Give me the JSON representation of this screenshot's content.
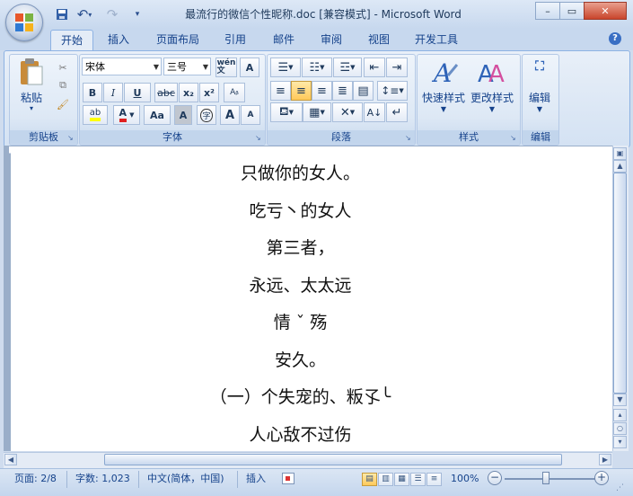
{
  "window": {
    "title": "最流行的微信个性昵称.doc [兼容模式] - Microsoft Word",
    "minimize": "–",
    "restore": "▭",
    "close": "✕"
  },
  "qat": {
    "save": "💾",
    "undo": "↶",
    "redo": "↷",
    "customize": "▾"
  },
  "tabs": [
    "开始",
    "插入",
    "页面布局",
    "引用",
    "邮件",
    "审阅",
    "视图",
    "开发工具"
  ],
  "help": "?",
  "ribbon": {
    "clipboard": {
      "label": "剪贴板",
      "paste": "粘贴",
      "paste_arrow": "▾",
      "cut": "✂",
      "copy": "⧉",
      "format_painter": "🖌"
    },
    "font": {
      "label": "字体",
      "font_name": "宋体",
      "font_size": "三号",
      "phonetic": "wén\n文",
      "char_border": "A",
      "bold": "B",
      "italic": "I",
      "underline": "U",
      "strike": "abc",
      "subscript": "x₂",
      "superscript": "x²",
      "clear": "Aᵦ",
      "highlight": "ab",
      "font_color": "A",
      "change_case": "Aa",
      "char_shading": "A",
      "enclose": "字",
      "grow": "A",
      "shrink": "A"
    },
    "paragraph": {
      "label": "段落"
    },
    "styles": {
      "label": "样式",
      "quick_styles": "快速样式",
      "change_styles": "更改样式"
    },
    "editing": {
      "label": "编辑",
      "button": "编辑"
    }
  },
  "document": {
    "lines": [
      "只做你的女人。",
      "吃亏丶的女人",
      "第三者，",
      "永远、太太远",
      "情 ˇ 殇",
      "安久。",
      "（一）个失宠的、粄孓╰",
      "人心敌不过伤"
    ]
  },
  "status": {
    "page": "页面: 2/8",
    "words": "字数: 1,023",
    "language": "中文(简体，中国)",
    "insert_mode": "插入",
    "zoom": "100%",
    "zoom_out": "−",
    "zoom_in": "+"
  },
  "colors": {
    "highlight": "#ffff00",
    "font_color": "#e02020",
    "accent": "#15428b"
  }
}
